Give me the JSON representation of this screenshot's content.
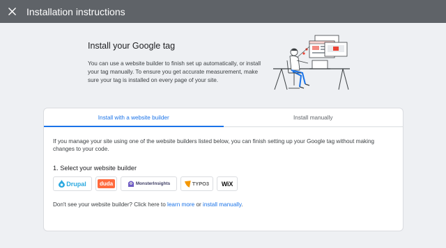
{
  "header": {
    "title": "Installation instructions"
  },
  "hero": {
    "title": "Install your Google tag",
    "description": "You can use a website builder to finish set up automatically, or install your tag manually. To ensure you get accurate measurement, make sure your tag is installed on every page of your site."
  },
  "tabs": [
    {
      "label": "Install with a website builder",
      "active": true
    },
    {
      "label": "Install manually",
      "active": false
    }
  ],
  "content": {
    "intro": "If you manage your site using one of the website builders listed below, you can finish setting up your Google tag without making changes to your code.",
    "step_label": "1. Select your website builder",
    "builders": [
      {
        "name": "Drupal",
        "icon": "drupal-drop-icon"
      },
      {
        "name": "duda"
      },
      {
        "name": "MonsterInsights",
        "icon": "monsterinsights-mascot-icon"
      },
      {
        "name": "TYPO3",
        "icon": "typo3-logo-icon"
      },
      {
        "name": "WiX"
      }
    ],
    "footer_text": "Don't see your website builder? Click here to",
    "footer_link_1": "learn more",
    "footer_or": "or",
    "footer_link_2": "install manually",
    "footer_end": "."
  },
  "colors": {
    "topbar": "#5f6368",
    "accent": "#1a73e8",
    "background": "#eef0f3"
  }
}
